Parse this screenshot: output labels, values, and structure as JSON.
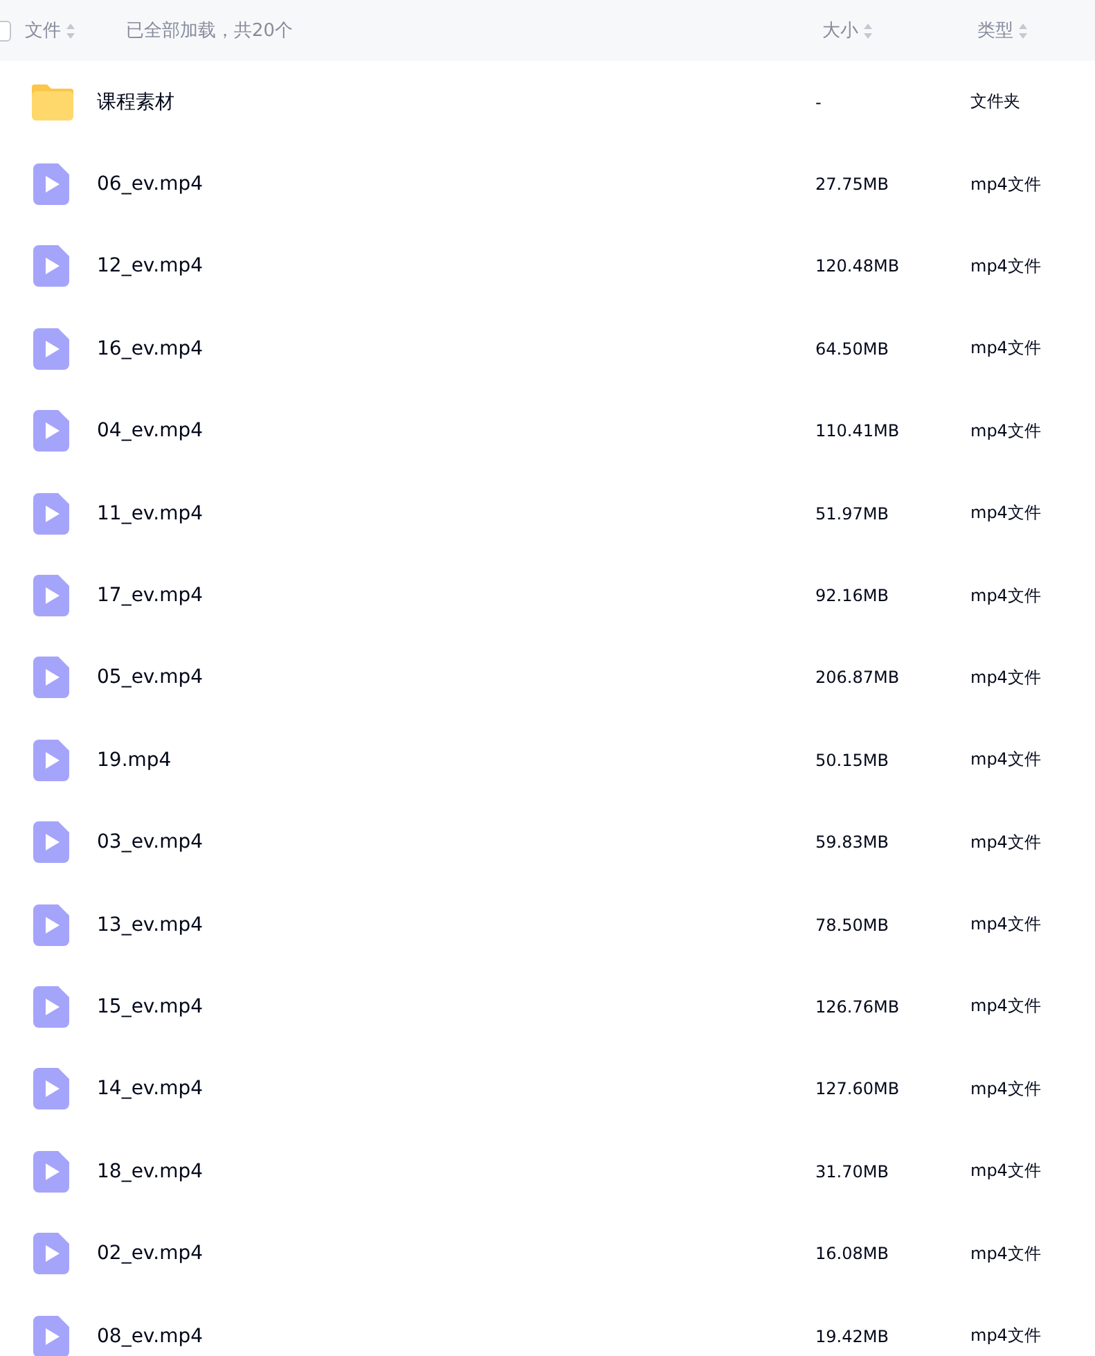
{
  "header": {
    "select_all": {
      "checked": false
    },
    "name_column": "文件",
    "load_status": "已全部加载，共20个",
    "size_column": "大小",
    "type_column": "类型"
  },
  "rows": [
    {
      "kind": "folder",
      "name": "课程素材",
      "size": "-",
      "type": "文件夹"
    },
    {
      "kind": "video",
      "name": "06_ev.mp4",
      "size": "27.75MB",
      "type": "mp4文件"
    },
    {
      "kind": "video",
      "name": "12_ev.mp4",
      "size": "120.48MB",
      "type": "mp4文件"
    },
    {
      "kind": "video",
      "name": "16_ev.mp4",
      "size": "64.50MB",
      "type": "mp4文件"
    },
    {
      "kind": "video",
      "name": "04_ev.mp4",
      "size": "110.41MB",
      "type": "mp4文件"
    },
    {
      "kind": "video",
      "name": "11_ev.mp4",
      "size": "51.97MB",
      "type": "mp4文件"
    },
    {
      "kind": "video",
      "name": "17_ev.mp4",
      "size": "92.16MB",
      "type": "mp4文件"
    },
    {
      "kind": "video",
      "name": "05_ev.mp4",
      "size": "206.87MB",
      "type": "mp4文件"
    },
    {
      "kind": "video",
      "name": "19.mp4",
      "size": "50.15MB",
      "type": "mp4文件"
    },
    {
      "kind": "video",
      "name": "03_ev.mp4",
      "size": "59.83MB",
      "type": "mp4文件"
    },
    {
      "kind": "video",
      "name": "13_ev.mp4",
      "size": "78.50MB",
      "type": "mp4文件"
    },
    {
      "kind": "video",
      "name": "15_ev.mp4",
      "size": "126.76MB",
      "type": "mp4文件"
    },
    {
      "kind": "video",
      "name": "14_ev.mp4",
      "size": "127.60MB",
      "type": "mp4文件"
    },
    {
      "kind": "video",
      "name": "18_ev.mp4",
      "size": "31.70MB",
      "type": "mp4文件"
    },
    {
      "kind": "video",
      "name": "02_ev.mp4",
      "size": "16.08MB",
      "type": "mp4文件"
    },
    {
      "kind": "video",
      "name": "08_ev.mp4",
      "size": "19.42MB",
      "type": "mp4文件"
    }
  ]
}
